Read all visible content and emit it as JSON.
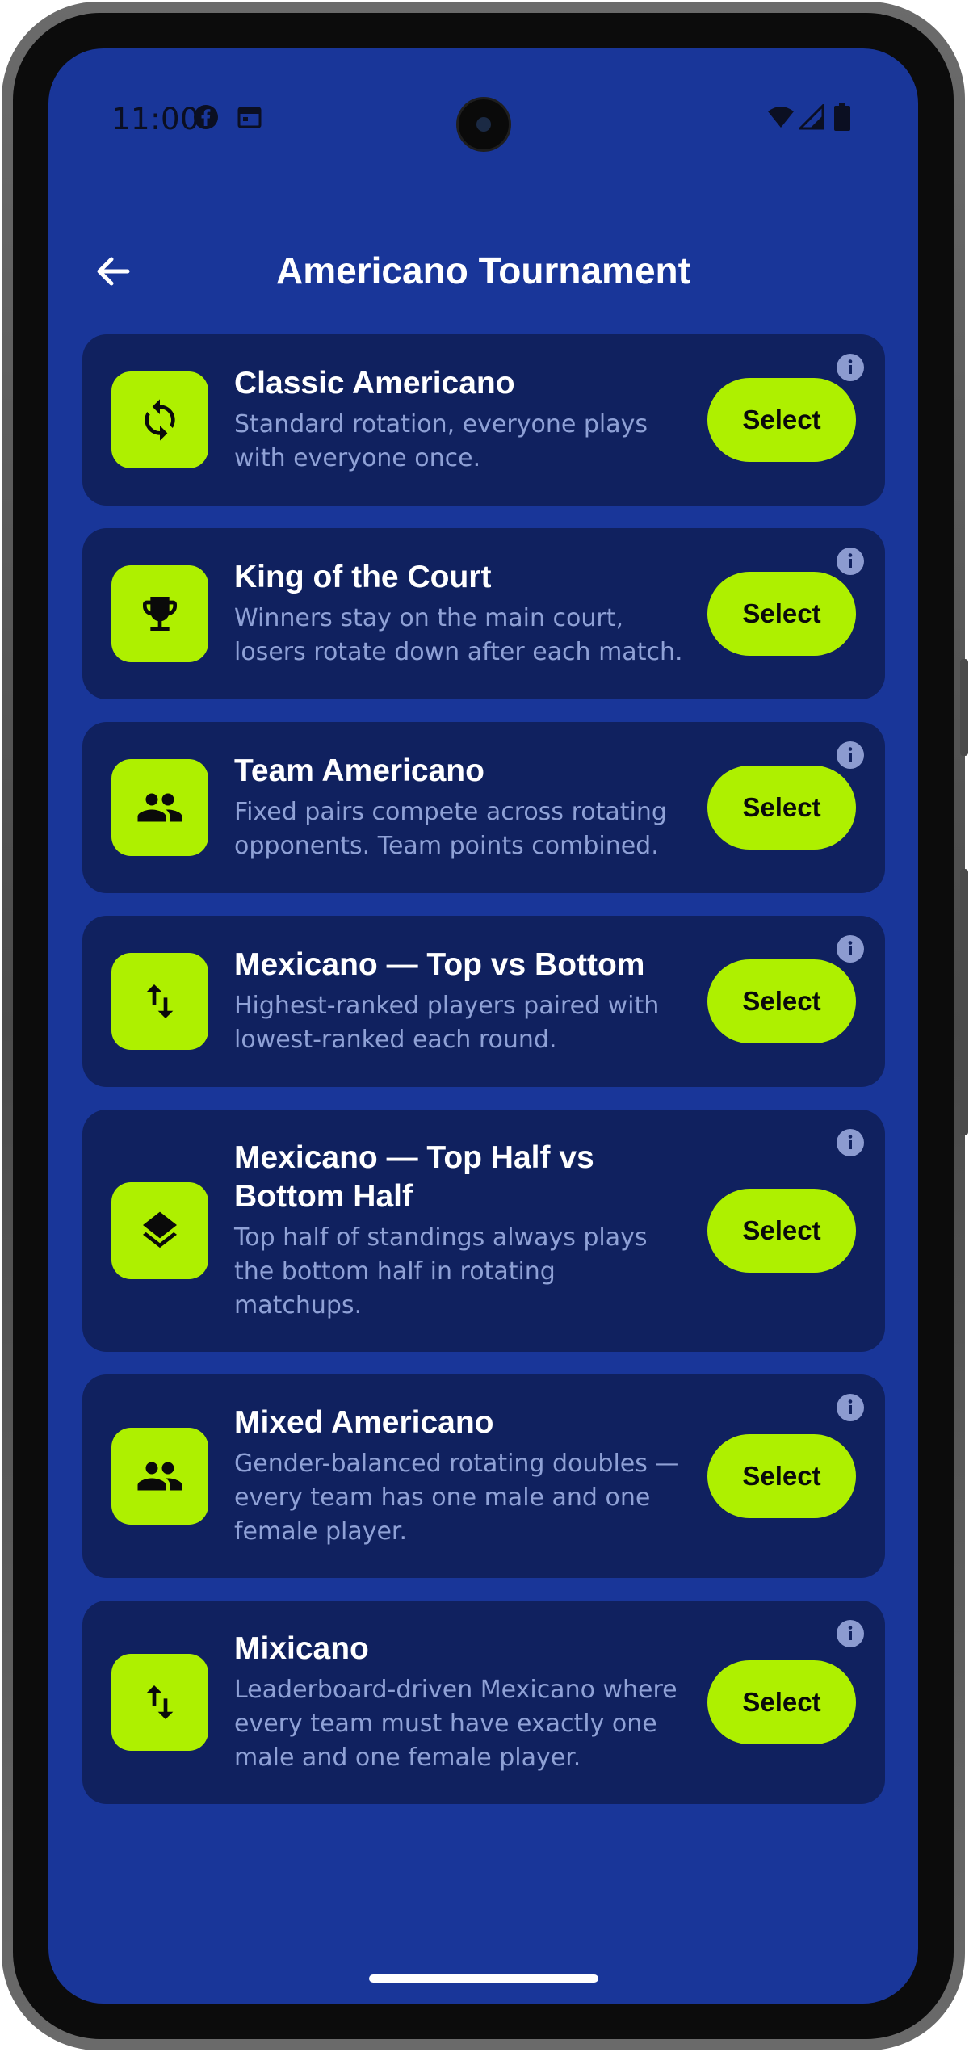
{
  "status_bar": {
    "time": "11:00",
    "left_icons": [
      "facebook-icon",
      "calendar-icon"
    ],
    "right_icons": [
      "wifi-icon",
      "signal-icon",
      "battery-icon"
    ]
  },
  "header": {
    "title": "Americano Tournament",
    "back_icon": "arrow-left-icon"
  },
  "colors": {
    "background": "#193699",
    "card": "#10215f",
    "accent": "#aef000",
    "title_text": "#ffffff",
    "description_text": "#8fa1d6",
    "info": "#8c9bd0"
  },
  "formats": [
    {
      "title": "Classic Americano",
      "description": "Standard rotation, everyone plays with everyone once.",
      "icon": "rotate-icon",
      "button_label": "Select"
    },
    {
      "title": "King of the Court",
      "description": "Winners stay on the main court, losers rotate down after each match.",
      "icon": "trophy-icon",
      "button_label": "Select"
    },
    {
      "title": "Team Americano",
      "description": "Fixed pairs compete across rotating opponents. Team points combined.",
      "icon": "people-icon",
      "button_label": "Select"
    },
    {
      "title": "Mexicano — Top vs Bottom",
      "description": "Highest-ranked players paired with lowest-ranked each round.",
      "icon": "swap-vertical-icon",
      "button_label": "Select"
    },
    {
      "title": "Mexicano — Top Half vs Bottom Half",
      "description": "Top half of standings always plays the bottom half in rotating matchups.",
      "icon": "layers-icon",
      "button_label": "Select"
    },
    {
      "title": "Mixed Americano",
      "description": "Gender-balanced rotating doubles — every team has one male and one female player.",
      "icon": "people-icon",
      "button_label": "Select"
    },
    {
      "title": "Mixicano",
      "description": "Leaderboard-driven Mexicano where every team must have exactly one male and one female player.",
      "icon": "swap-vertical-icon",
      "button_label": "Select"
    }
  ]
}
